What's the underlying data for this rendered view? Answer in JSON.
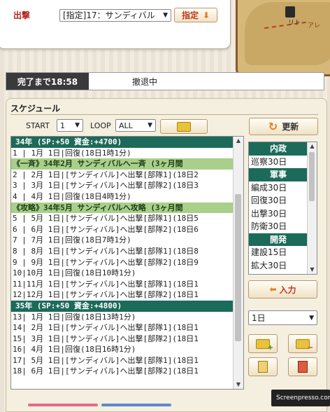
{
  "top": {
    "sortie_label": "出撃",
    "target_select": "[指定]17：サンディバル",
    "designate_label": "指定"
  },
  "map": {
    "label_a": "リト",
    "label_b": "アレ"
  },
  "status": {
    "label": "完了まで18:58",
    "text": "撤退中"
  },
  "schedule": {
    "title": "スケジュール",
    "start_label": "START",
    "start_value": "1",
    "loop_label": "LOOP",
    "loop_value": "ALL",
    "refresh_label": "更新",
    "rows": [
      {
        "type": "year",
        "text": "34年 (SP:+50 資金:+4700)"
      },
      {
        "type": "sel",
        "text": "1 | 1月 1日|回復(18日1時1分)"
      },
      {
        "type": "event",
        "text": "《一斉》34年2月 サンディバルへ一斉 (3ヶ月間"
      },
      {
        "type": "row",
        "text": "2 | 2月 1日|[サンディバル]へ出撃[部隊1](18日2"
      },
      {
        "type": "row",
        "text": "3 | 3月 1日|[サンディバル]へ出撃[部隊2](18日3"
      },
      {
        "type": "row",
        "text": "4 | 4月 1日|回復(18日4時1分)"
      },
      {
        "type": "event",
        "text": "《攻略》34年5月 サンディバルへ攻略 (3ヶ月間"
      },
      {
        "type": "row",
        "text": "5 | 5月 1日|[サンディバル]へ出撃[部隊1](18日5"
      },
      {
        "type": "row",
        "text": "6 | 6月 1日|[サンディバル]へ出撃[部隊2](18日6"
      },
      {
        "type": "row",
        "text": "7 | 7月 1日|回復(18日7時1分)"
      },
      {
        "type": "row",
        "text": "8 | 8月 1日|[サンディバル]へ出撃[部隊1](18日8"
      },
      {
        "type": "row",
        "text": "9 | 9月 1日|[サンディバル]へ出撃[部隊2](18日9"
      },
      {
        "type": "row",
        "text": "10|10月 1日|回復(18日10時1分)"
      },
      {
        "type": "row",
        "text": "11|11月 1日|[サンディバル]へ出撃[部隊1](18日1"
      },
      {
        "type": "row",
        "text": "12|12月 1日|[サンディバル]へ出撃[部隊2](18日1"
      },
      {
        "type": "year",
        "text": "35年 (SP:+50 資金:+4800)"
      },
      {
        "type": "row",
        "text": "13| 1月 1日|回復(18日13時1分)"
      },
      {
        "type": "row",
        "text": "14| 2月 1日|[サンディバル]へ出撃[部隊1](18日1"
      },
      {
        "type": "row",
        "text": "15| 3月 1日|[サンディバル]へ出撃[部隊2](18日1"
      },
      {
        "type": "row",
        "text": "16| 4月 1日|回復(18日16時1分)"
      },
      {
        "type": "row",
        "text": "17| 5月 1日|[サンディバル]へ出撃[部隊1](18日1"
      },
      {
        "type": "row",
        "text": "18| 6月 1日|[サンディバル]へ出撃[部隊2](18日1"
      }
    ]
  },
  "commands": [
    {
      "type": "hdr",
      "text": "内政"
    },
    {
      "type": "item",
      "text": "巡察30日"
    },
    {
      "type": "hdr",
      "text": "軍事"
    },
    {
      "type": "item",
      "text": "編成30日"
    },
    {
      "type": "item",
      "text": "回復30日"
    },
    {
      "type": "item",
      "text": "出撃30日"
    },
    {
      "type": "item",
      "text": "防衛30日"
    },
    {
      "type": "hdr",
      "text": "開発"
    },
    {
      "type": "item",
      "text": "建設15日"
    },
    {
      "type": "item",
      "text": "拡大30日"
    }
  ],
  "side": {
    "input_label": "入力",
    "days_value": "1日"
  },
  "watermark": "Screenpresso.com"
}
